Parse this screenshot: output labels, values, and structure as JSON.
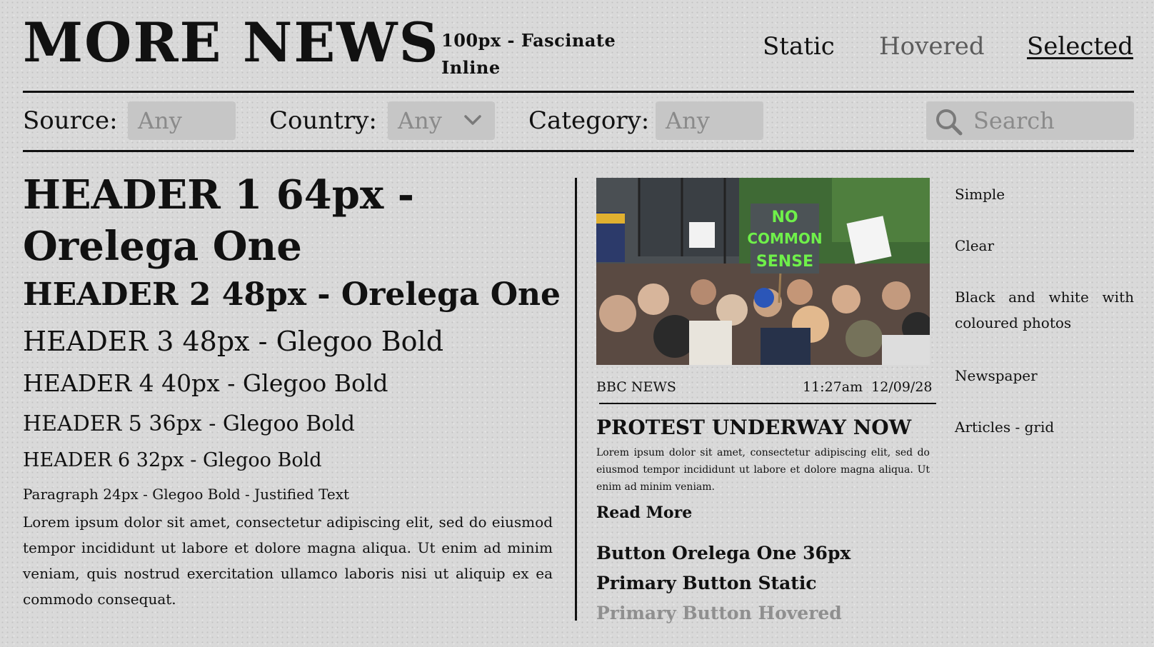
{
  "header": {
    "logo": "MORE NEWS",
    "logo_note": "100px - Fascinate Inline",
    "nav": {
      "static": "Static",
      "hovered": "Hovered",
      "selected": "Selected"
    }
  },
  "filters": {
    "source": {
      "label": "Source:",
      "value": "Any"
    },
    "country": {
      "label": "Country:",
      "value": "Any"
    },
    "category": {
      "label": "Category:",
      "value": "Any"
    },
    "search": {
      "placeholder": "Search"
    }
  },
  "typography": {
    "h1": "HEADER 1 64px - Orelega One",
    "h2": "HEADER 2 48px - Orelega One",
    "h3": "HEADER 3 48px - Glegoo Bold",
    "h4": "HEADER 4 40px - Glegoo Bold",
    "h5": "HEADER 5 36px - Glegoo Bold",
    "h6": "HEADER 6 32px - Glegoo Bold",
    "paragraph_label": "Paragraph 24px - Glegoo Bold - Justified Text",
    "paragraph": "Lorem ipsum dolor sit amet, consectetur adipiscing elit, sed do eiusmod tempor incididunt ut labore et dolore magna aliqua. Ut enim ad minim veniam, quis nostrud exercitation ullamco laboris nisi ut aliquip ex ea commodo consequat."
  },
  "article": {
    "source": "BBC NEWS",
    "timestamp": "11:27am  12/09/28",
    "title": "PROTEST UNDERWAY NOW",
    "excerpt": "Lorem ipsum dolor sit amet, consectetur adipiscing elit, sed do eiusmod tempor incididunt ut labore et dolore magna aliqua. Ut enim ad minim veniam.",
    "read_more": "Read More",
    "photo_sign_text": [
      "NO",
      "COMMON",
      "SENSE"
    ]
  },
  "buttons": {
    "label": "Button Orelega One 36px",
    "static": "Primary Button Static",
    "hovered": "Primary Button Hovered"
  },
  "style_notes": {
    "simple": "Simple",
    "clear": "Clear",
    "bw": "Black and white with coloured photos",
    "newspaper": "Newspaper",
    "articles": "Articles - grid"
  },
  "colors": {
    "background": "#d9d9d9",
    "ink": "#111111",
    "field_bg": "#c6c6c6",
    "placeholder": "#8a8a8a",
    "hover_text": "#8f8f8f"
  }
}
